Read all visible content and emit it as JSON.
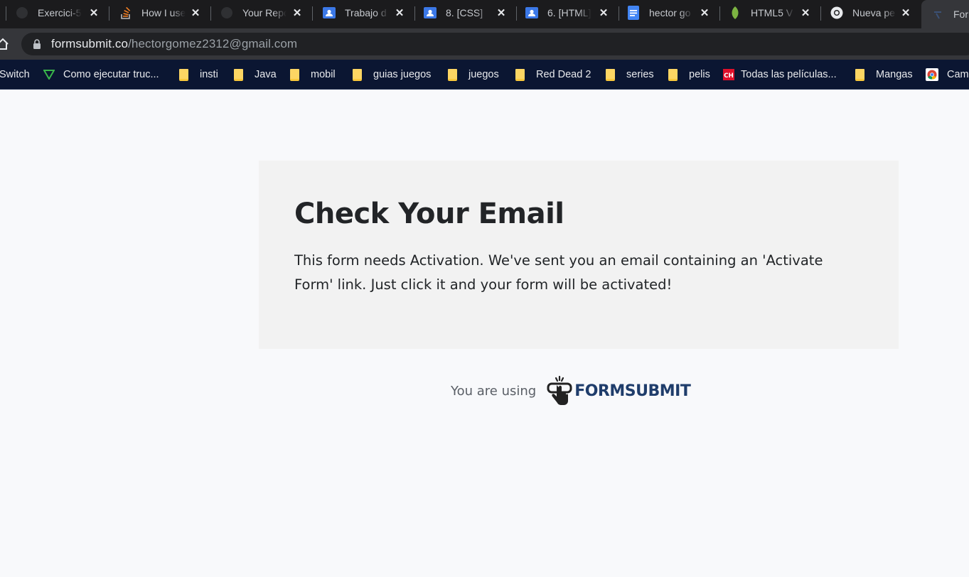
{
  "tabs": [
    {
      "title": "Exercici-5",
      "icon": "github-icon"
    },
    {
      "title": "How I use",
      "icon": "stackoverflow-icon"
    },
    {
      "title": "Your Repo",
      "icon": "github-icon"
    },
    {
      "title": "Trabajo d",
      "icon": "classroom-icon"
    },
    {
      "title": "8. [CSS]",
      "icon": "classroom-icon"
    },
    {
      "title": "6. [HTML]",
      "icon": "classroom-icon"
    },
    {
      "title": "hector go",
      "icon": "docs-icon"
    },
    {
      "title": "HTML5 V",
      "icon": "leaf-icon"
    },
    {
      "title": "Nueva pe",
      "icon": "chrome-icon"
    },
    {
      "title": "For",
      "icon": "formsubmit-icon"
    }
  ],
  "address": {
    "domain": "formsubmit.co",
    "path": "/hectorgomez2312@gmail.com"
  },
  "bookmarks": [
    {
      "label": "Switch",
      "icon": "none"
    },
    {
      "label": "Como ejecutar truc...",
      "icon": "triangle-icon"
    },
    {
      "label": "insti",
      "icon": "folder-icon"
    },
    {
      "label": "Java",
      "icon": "folder-icon"
    },
    {
      "label": "mobil",
      "icon": "folder-icon"
    },
    {
      "label": "guias juegos",
      "icon": "folder-icon"
    },
    {
      "label": "juegos",
      "icon": "folder-icon"
    },
    {
      "label": "Red Dead 2",
      "icon": "folder-icon"
    },
    {
      "label": "series",
      "icon": "folder-icon"
    },
    {
      "label": "pelis",
      "icon": "folder-icon"
    },
    {
      "label": "Todas las películas...",
      "icon": "ch-icon"
    },
    {
      "label": "Mangas",
      "icon": "folder-icon"
    },
    {
      "label": "Cam",
      "icon": "chrome-icon"
    }
  ],
  "main": {
    "heading": "Check Your Email",
    "message": "This form needs Activation. We've sent you an email containing an 'Activate Form' link. Just click it and your form will be activated!"
  },
  "footer": {
    "using_text": "You are using",
    "brand": "FORMSUBMIT"
  },
  "colors": {
    "brand": "#1f3d6b",
    "card_bg": "#f2f2f2",
    "bookmark_bar": "#0b1632"
  }
}
